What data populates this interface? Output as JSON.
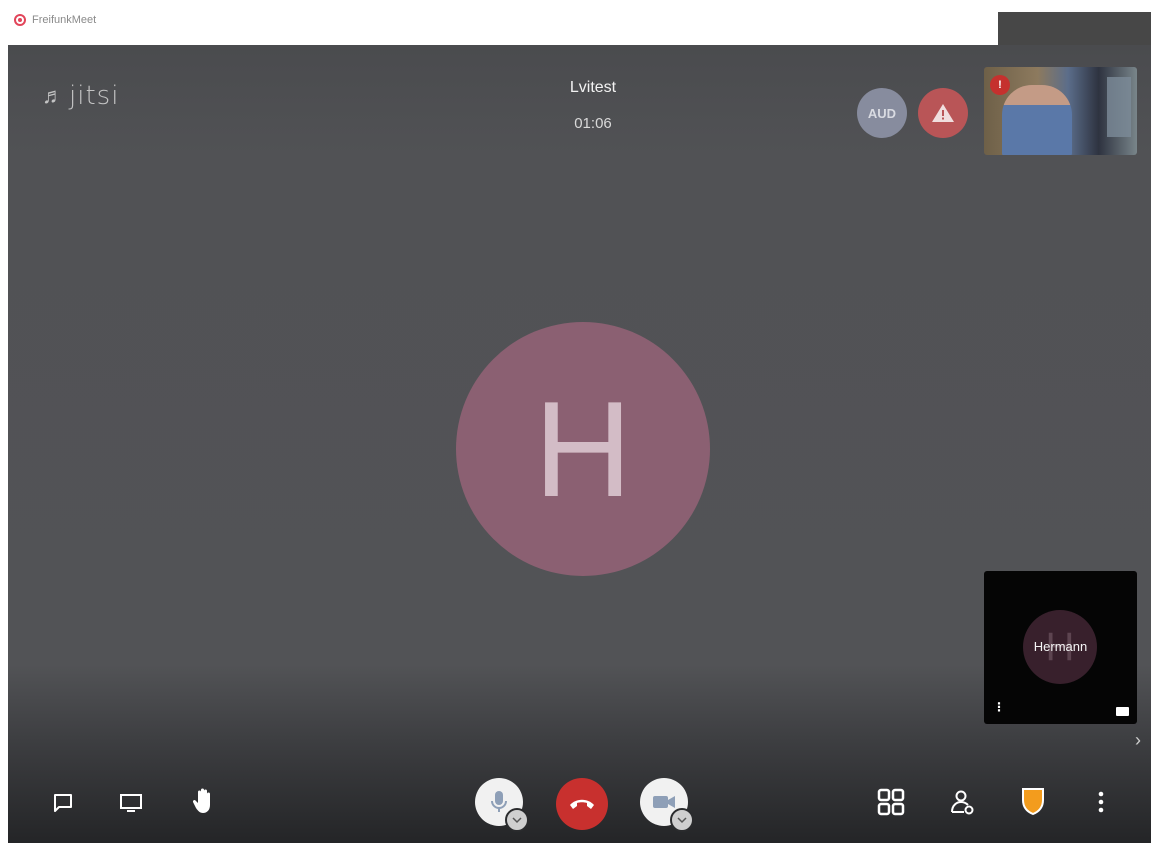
{
  "app": {
    "window_title": "FreifunkMeet",
    "logo_text": "jitsi"
  },
  "meeting": {
    "title": "Lvitest",
    "timer": "01:06"
  },
  "badges": {
    "audio_only": "AUD"
  },
  "participants": {
    "main_avatar_initial": "H",
    "local_initial": "H",
    "local_name": "Hermann"
  },
  "toolbar": {
    "left": [
      "chat-icon",
      "screenshare-icon",
      "raise-hand-icon"
    ],
    "center": [
      "microphone-icon",
      "hangup-icon",
      "camera-icon"
    ],
    "right": [
      "tile-view-icon",
      "invite-icon",
      "security-shield-icon",
      "more-icon"
    ]
  },
  "colors": {
    "stage": "#525356",
    "avatar_main": "#8b6072",
    "hangup": "#c8302e",
    "warning_badge": "#b95557",
    "audio_badge": "#878c9e",
    "shield": "#f39c1d",
    "brand": "#e2455a"
  }
}
